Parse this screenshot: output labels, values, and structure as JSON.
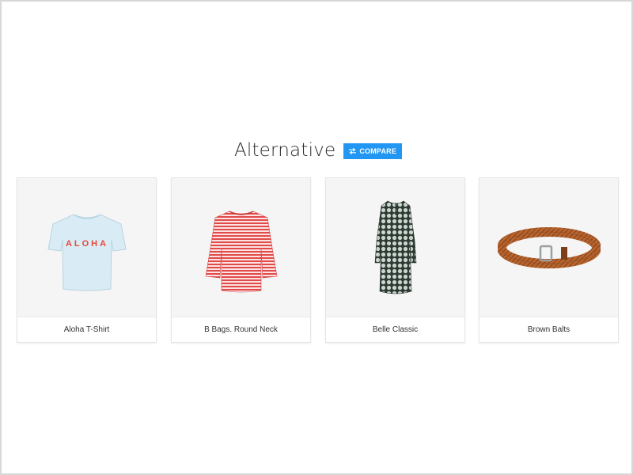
{
  "section": {
    "title": "Alternative",
    "compare_label": "COMPARE"
  },
  "products": [
    {
      "name": "Aloha T-Shirt",
      "print_text": "ALOHA",
      "icon": "t-shirt-image"
    },
    {
      "name": "B Bags. Round Neck",
      "icon": "striped-top-image"
    },
    {
      "name": "Belle Classic",
      "icon": "dress-image"
    },
    {
      "name": "Brown Balts",
      "icon": "belt-image"
    }
  ],
  "colors": {
    "accent": "#2196f3",
    "card_image_bg": "#f5f5f5"
  }
}
